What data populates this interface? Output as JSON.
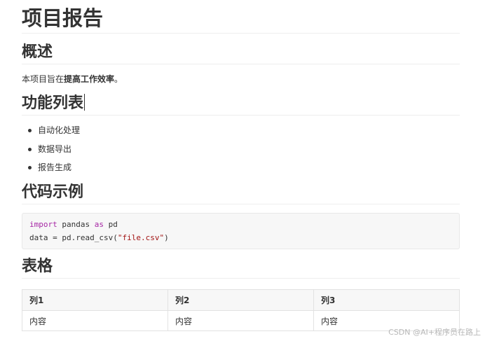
{
  "document": {
    "title": "项目报告",
    "overview": {
      "heading": "概述",
      "text_prefix": "本项目旨在",
      "text_strong": "提高工作效率",
      "text_suffix": "。"
    },
    "features": {
      "heading": "功能列表",
      "items": [
        "自动化处理",
        "数据导出",
        "报告生成"
      ]
    },
    "code": {
      "heading": "代码示例",
      "line1_kw1": "import",
      "line1_mid": " pandas ",
      "line1_kw2": "as",
      "line1_end": " pd",
      "line2_pre": "data = pd.read_csv(",
      "line2_str": "\"file.csv\"",
      "line2_end": ")"
    },
    "table": {
      "heading": "表格",
      "headers": [
        "列1",
        "列2",
        "列3"
      ],
      "rows": [
        [
          "内容",
          "内容",
          "内容"
        ]
      ]
    }
  },
  "watermark": "CSDN @AI+程序员在路上"
}
